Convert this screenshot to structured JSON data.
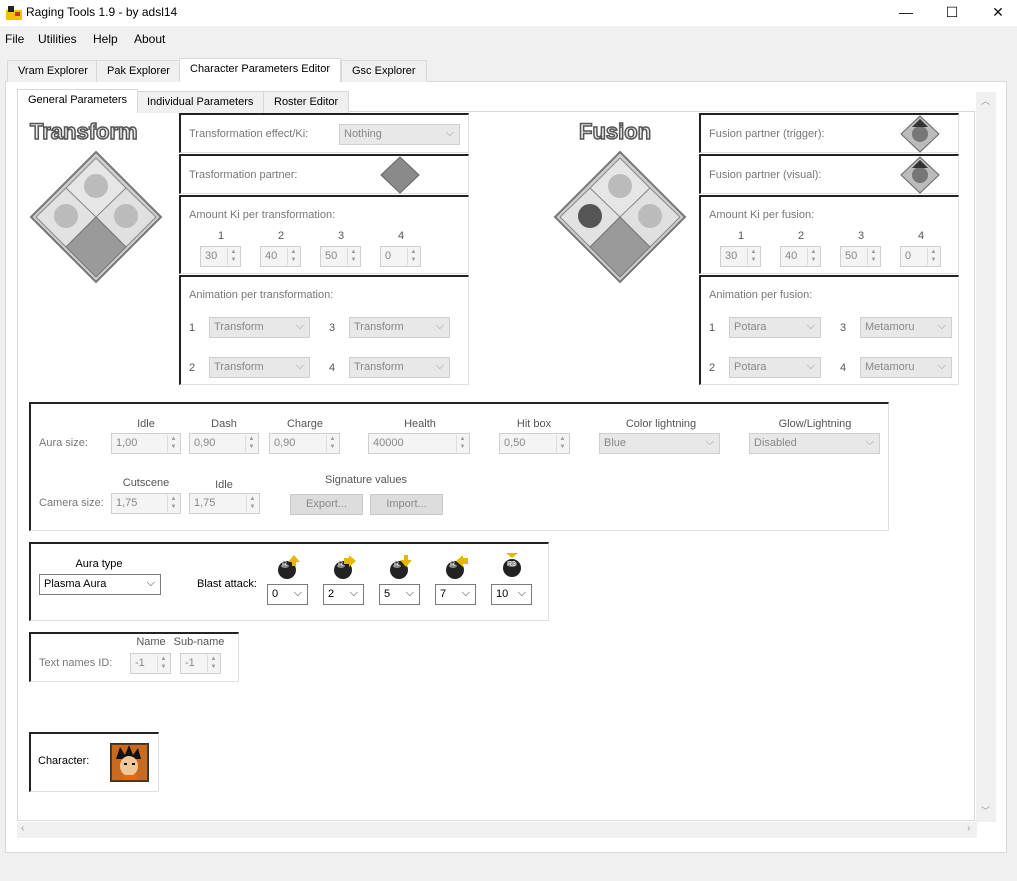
{
  "window": {
    "title": "Raging Tools 1.9 - by adsl14",
    "min": "—",
    "max": "☐",
    "close": "✕"
  },
  "menu": [
    "File",
    "Utilities",
    "Help",
    "About"
  ],
  "main_tabs": [
    "Vram Explorer",
    "Pak Explorer",
    "Character Parameters Editor",
    "Gsc Explorer"
  ],
  "sub_tabs": [
    "General Parameters",
    "Individual Parameters",
    "Roster Editor"
  ],
  "transform": {
    "title": "Transform",
    "effect_label": "Transformation effect/Ki:",
    "effect_value": "Nothing",
    "partner_label": "Trasformation partner:",
    "ki_label": "Amount Ki per transformation:",
    "ki_headers": [
      "1",
      "2",
      "3",
      "4"
    ],
    "ki_values": [
      "30",
      "40",
      "50",
      "0"
    ],
    "anim_label": "Animation per transformation:",
    "anim_nums": [
      "1",
      "2",
      "3",
      "4"
    ],
    "anim_values": [
      "Transform",
      "Transform",
      "Transform",
      "Transform"
    ]
  },
  "fusion": {
    "title": "Fusion",
    "trigger_label": "Fusion partner (trigger):",
    "visual_label": "Fusion partner (visual):",
    "ki_label": "Amount Ki per fusion:",
    "ki_headers": [
      "1",
      "2",
      "3",
      "4"
    ],
    "ki_values": [
      "30",
      "40",
      "50",
      "0"
    ],
    "anim_label": "Animation per fusion:",
    "anim_nums": [
      "1",
      "2",
      "3",
      "4"
    ],
    "anim_values": [
      "Potara",
      "Potara",
      "Metamoru",
      "Metamoru"
    ]
  },
  "aura": {
    "aura_size_label": "Aura size:",
    "headers": [
      "Idle",
      "Dash",
      "Charge",
      "Health",
      "Hit box",
      "Color lightning",
      "Glow/Lightning"
    ],
    "idle": "1,00",
    "dash": "0,90",
    "charge": "0,90",
    "health": "40000",
    "hitbox": "0,50",
    "color": "Blue",
    "glow": "Disabled",
    "camera_label": "Camera size:",
    "camera_headers": [
      "Cutscene",
      "Idle"
    ],
    "cutscene": "1,75",
    "camera_idle": "1,75",
    "signature_label": "Signature values",
    "export": "Export...",
    "import": "Import..."
  },
  "aura_type": {
    "label": "Aura type",
    "value": "Plasma Aura",
    "blast_label": "Blast attack:",
    "blast_values": [
      "0",
      "2",
      "5",
      "7",
      "10"
    ],
    "blast_icons": [
      "r-up-icon",
      "r-right-icon",
      "r-down-icon",
      "r-left-icon",
      "r3-icon"
    ]
  },
  "text_names": {
    "label": "Text names ID:",
    "headers": [
      "Name",
      "Sub-name"
    ],
    "name": "-1",
    "subname": "-1"
  },
  "character": {
    "label": "Character:"
  },
  "colors": {
    "group_border": "#222222",
    "disabled_bg": "#e8e8e8",
    "page_bg": "#ffffff",
    "window_bg": "#f0f0f0"
  }
}
